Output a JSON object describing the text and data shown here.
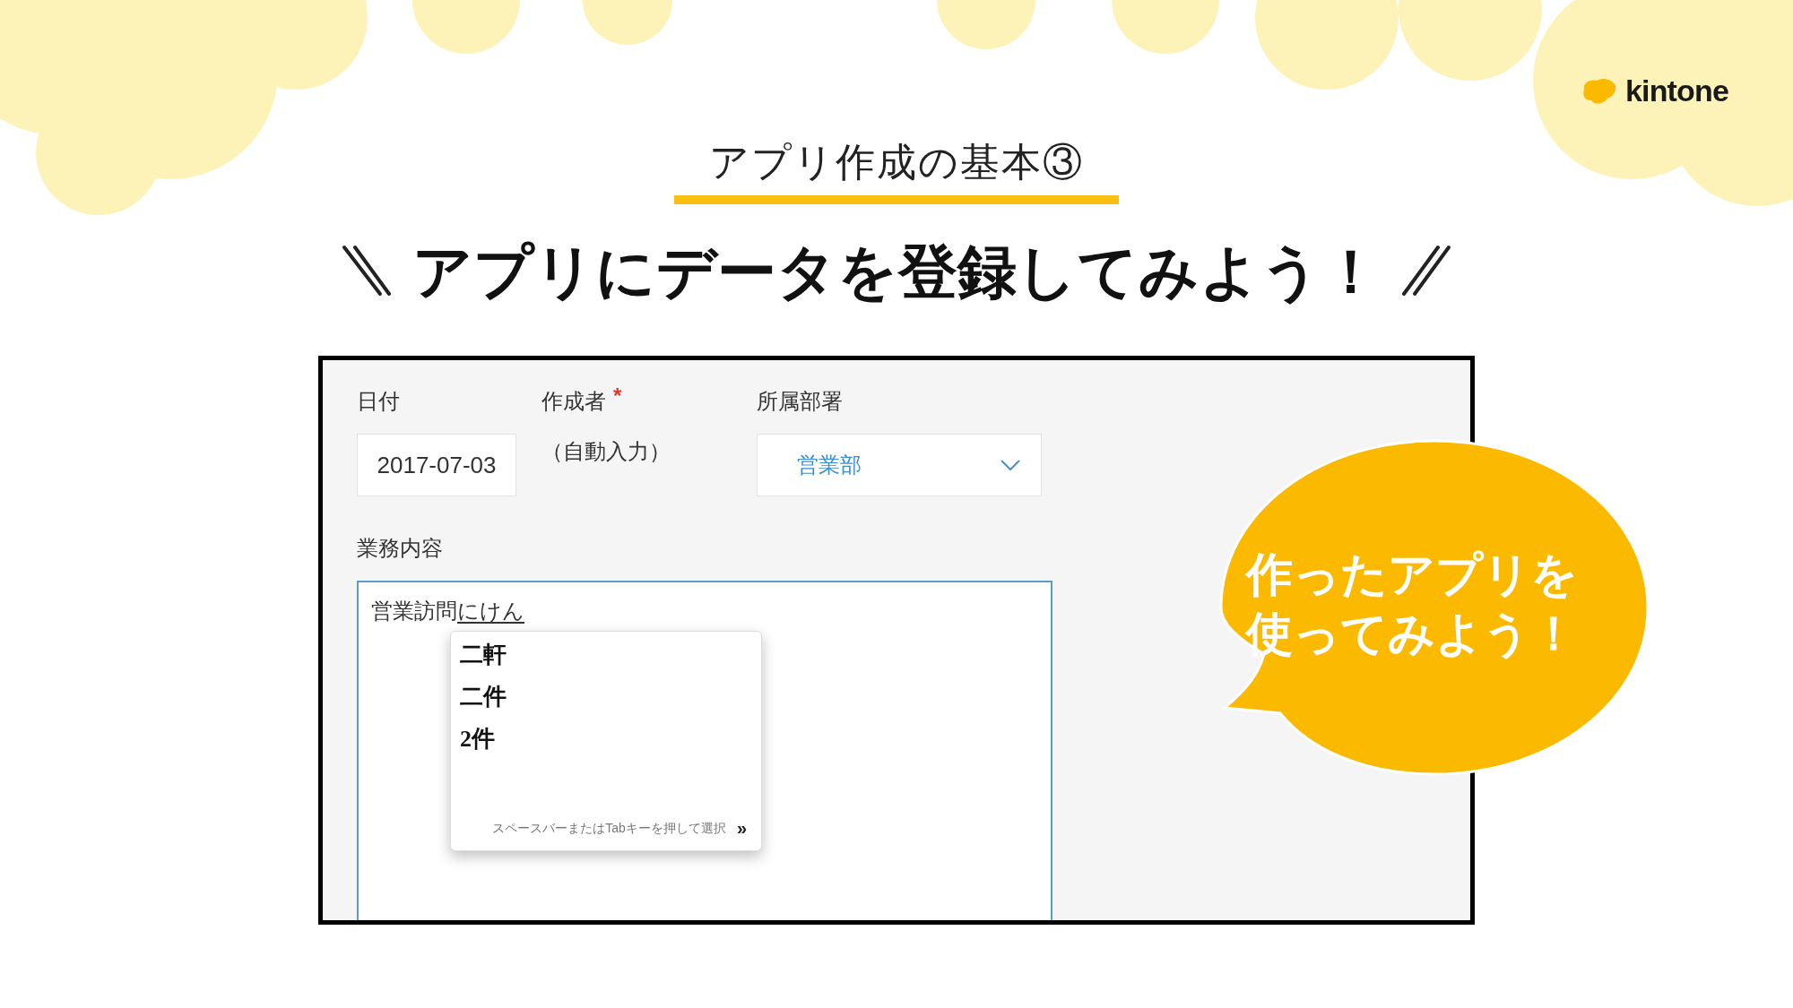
{
  "logo": {
    "text": "kintone"
  },
  "subtitle": "アプリ作成の基本③",
  "headline": "アプリにデータを登録してみよう！",
  "form": {
    "fields": [
      {
        "kind": "input",
        "label": "日付",
        "value": "2017-07-03"
      },
      {
        "kind": "auto",
        "label": "作成者",
        "required_mark": "*",
        "value": "（自動入力）"
      },
      {
        "kind": "dropdown",
        "label": "所属部署",
        "value": "営業部"
      }
    ],
    "textarea": {
      "label": "業務内容",
      "committed": "営業訪問",
      "composing": "にけん"
    },
    "ime_popup": {
      "candidates": [
        "二軒",
        "二件",
        "2件"
      ],
      "hint": "スペースバーまたはTabキーを押して選択",
      "hint_arrow": "»"
    }
  },
  "bubble": {
    "lines": [
      "作ったアプリを",
      "使ってみよう！"
    ]
  }
}
